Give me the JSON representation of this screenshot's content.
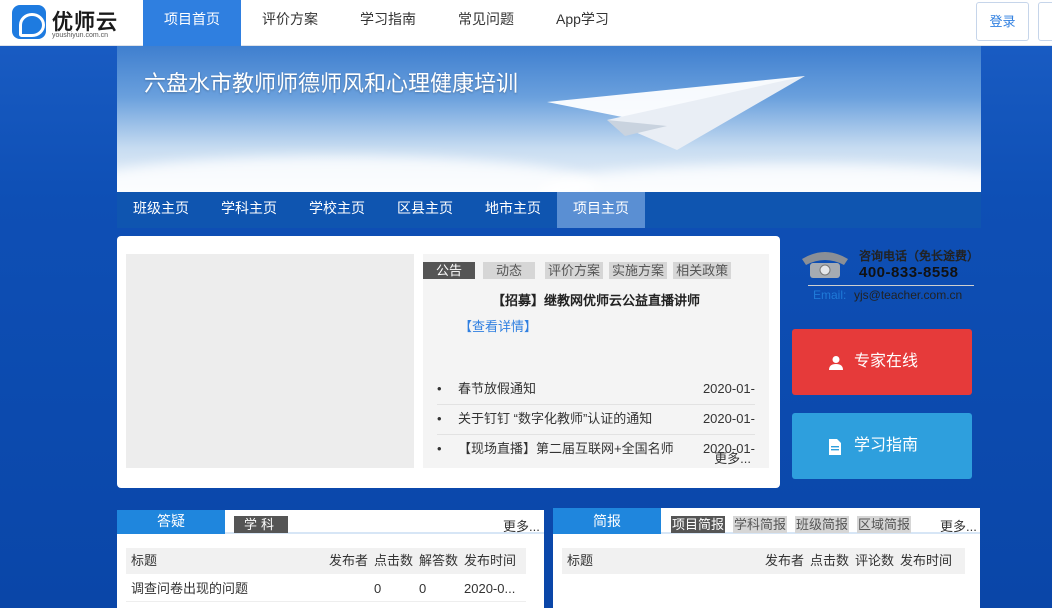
{
  "header": {
    "logo_text": "优师云",
    "logo_sub": "youshiyun.com.cn",
    "nav": [
      {
        "label": "项目首页"
      },
      {
        "label": "评价方案"
      },
      {
        "label": "学习指南"
      },
      {
        "label": "常见问题"
      },
      {
        "label": "App学习"
      }
    ],
    "login_label": "登录"
  },
  "banner": {
    "title": "六盘水市教师师德师风和心理健康培训"
  },
  "subnav": [
    {
      "label": "班级主页"
    },
    {
      "label": "学科主页"
    },
    {
      "label": "学校主页"
    },
    {
      "label": "区县主页"
    },
    {
      "label": "地市主页"
    },
    {
      "label": "项目主页"
    }
  ],
  "notices": {
    "tabs": [
      {
        "label": "公告"
      },
      {
        "label": "动态"
      },
      {
        "label": "评价方案"
      },
      {
        "label": "实施方案"
      },
      {
        "label": "相关政策"
      }
    ],
    "headline": "【招募】继教网优师云公益直播讲师",
    "detail_link": "【查看详情】",
    "items": [
      {
        "title": "春节放假通知",
        "date": "2020-01-"
      },
      {
        "title": "关于钉钉 “数字化教师”认证的通知",
        "date": "2020-01-"
      },
      {
        "title": "【现场直播】第二届互联网+全国名师",
        "date": "2020-01-"
      }
    ],
    "bullet": "•",
    "more": "更多..."
  },
  "contact": {
    "label": "咨询电话（免长途费）",
    "phone": "400-833-8558",
    "email_label": "Email:",
    "email": "yjs@teacher.com.cn"
  },
  "actions": {
    "expert_label": "专家在线",
    "guide_label": "学习指南"
  },
  "qa": {
    "title": "答疑",
    "subtab": "学科",
    "more": "更多...",
    "columns": [
      "标题",
      "发布者",
      "点击数",
      "解答数",
      "发布时间"
    ],
    "rows": [
      {
        "title": "调查问卷出现的问题",
        "author": "",
        "clicks": "0",
        "answers": "0",
        "time": "2020-0..."
      }
    ]
  },
  "brief": {
    "title": "简报",
    "subtabs": [
      {
        "label": "项目简报"
      },
      {
        "label": "学科简报"
      },
      {
        "label": "班级简报"
      },
      {
        "label": "区域简报"
      }
    ],
    "more": "更多...",
    "columns": [
      "标题",
      "发布者",
      "点击数",
      "评论数",
      "发布时间"
    ]
  },
  "colors": {
    "primary": "#2f7fe0",
    "subnav_bg": "#0f55b0",
    "expert_btn": "#e63a3a",
    "guide_btn": "#2e9fdd",
    "page_bg": "#0e4fb5"
  },
  "icons": {
    "logo": "logo-cloud-icon",
    "plane": "paper-plane-icon",
    "phone": "telephone-icon",
    "expert": "user-icon",
    "guide": "document-icon"
  }
}
